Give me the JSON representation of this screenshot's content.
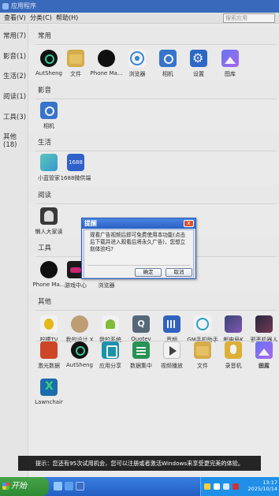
{
  "window": {
    "title": "应用程序"
  },
  "menubar": {
    "items": [
      "查看(V)",
      "分类(C)",
      "帮助(H)"
    ],
    "search_placeholder": "搜索应用"
  },
  "sidebar": {
    "items": [
      "常用(7)",
      "影音(1)",
      "生活(2)",
      "阅读(1)",
      "工具(3)",
      "其他(18)"
    ]
  },
  "sections": {
    "common": {
      "header": "常用",
      "apps": [
        "AutSheng",
        "文件",
        "Phone Ma...",
        "浏览器",
        "相机",
        "设置",
        "图库"
      ]
    },
    "media": {
      "header": "影音",
      "apps": [
        "相机"
      ]
    },
    "life": {
      "header": "生活",
      "apps": [
        "小蓝管家",
        "1688微供端"
      ]
    },
    "reading": {
      "header": "阅读",
      "apps": [
        "懒人大家读"
      ]
    },
    "tools": {
      "header": "工具",
      "apps": [
        "Phone Ma...",
        "游戏中心",
        "浏览器"
      ]
    },
    "other": {
      "header": "其他",
      "apps_row1": [
        "柠檬TV",
        "我的设计 X",
        "我的系统",
        "Quotev",
        "音频",
        "GM手机助手",
        "邮电局K",
        "邪恶机器人"
      ],
      "apps_row2": [
        "激光数据",
        "AutSheng",
        "应用分享",
        "数据集中",
        "视频播放",
        "文件",
        "录音机",
        "设置",
        "图库"
      ],
      "apps_row3": [
        "Lawnchair"
      ]
    }
  },
  "dialog": {
    "title": "提醒",
    "close_glyph": "x",
    "message": "观看广告视频后即可免费使用本功能(点击后下载并进入观看后将永久广告)，您想立刻体验吗?",
    "ok_label": "确定",
    "cancel_label": "取消"
  },
  "toast": {
    "text": "提示：您还有95次试用机会，您可以注册或者激活Windows来享受更完美的体验。"
  },
  "taskbar": {
    "start_label": "开始",
    "time": "13:17",
    "date": "2025/10/14"
  },
  "colors": {
    "title_bar": "#3c6fc4",
    "dialog_title": "#2a61c3",
    "taskbar": "#225fc4",
    "start_button": "#2f8a33"
  }
}
